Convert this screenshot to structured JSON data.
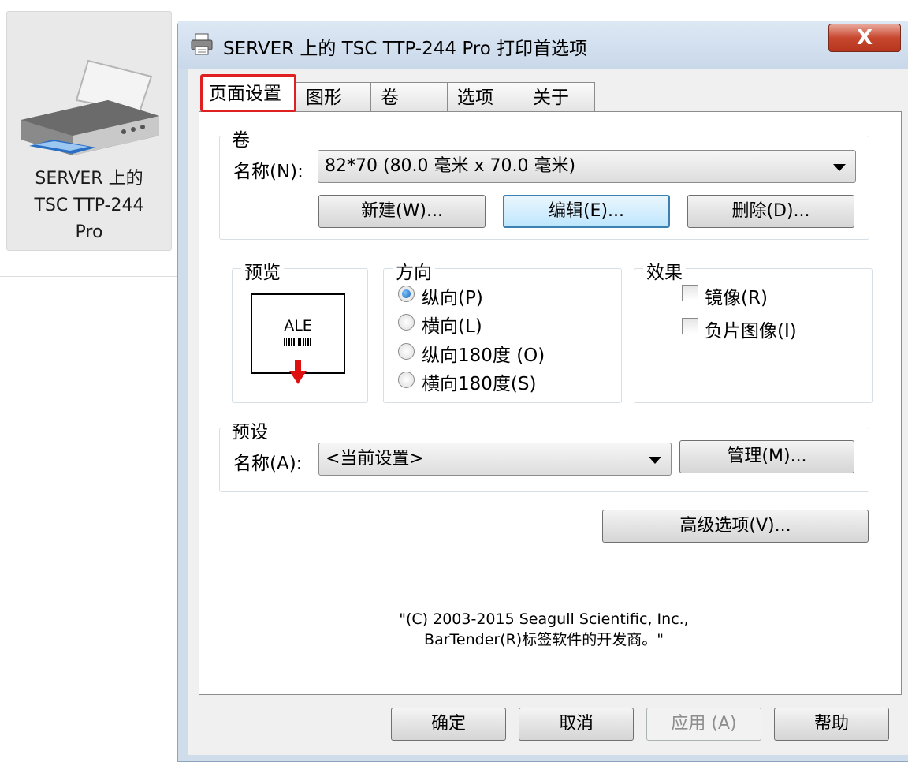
{
  "printer": {
    "label_lines": [
      "SERVER 上的",
      "TSC TTP-244",
      "Pro"
    ]
  },
  "window": {
    "title": "SERVER 上的 TSC TTP-244 Pro 打印首选项",
    "close_glyph": "X"
  },
  "tabs": [
    {
      "label": "页面设置",
      "selected": true
    },
    {
      "label": "图形"
    },
    {
      "label": "卷"
    },
    {
      "label": "选项"
    },
    {
      "label": "关于"
    }
  ],
  "stock": {
    "group_title": "卷",
    "name_label": "名称(N):",
    "selected": "82*70 (80.0 毫米 x 70.0 毫米)",
    "new_button": "新建(W)...",
    "edit_button": "编辑(E)...",
    "delete_button": "删除(D)..."
  },
  "preview": {
    "group_title": "预览",
    "sample_text": "ALE"
  },
  "orientation": {
    "group_title": "方向",
    "options": [
      {
        "label": "纵向(P)",
        "checked": true
      },
      {
        "label": "横向(L)",
        "checked": false
      },
      {
        "label": "纵向180度 (O)",
        "checked": false
      },
      {
        "label": "横向180度(S)",
        "checked": false
      }
    ]
  },
  "effects": {
    "group_title": "效果",
    "options": [
      {
        "label": "镜像(R)",
        "checked": false
      },
      {
        "label": "负片图像(I)",
        "checked": false
      }
    ]
  },
  "preset": {
    "group_title": "预设",
    "name_label": "名称(A):",
    "selected": "<当前设置>",
    "manage_button": "管理(M)..."
  },
  "advanced_button": "高级选项(V)...",
  "copyright": [
    "\"(C) 2003-2015 Seagull Scientific, Inc.,",
    "BarTender(R)标签软件的开发商。\""
  ],
  "footer": {
    "ok": "确定",
    "cancel": "取消",
    "apply": "应用 (A)",
    "help": "帮助"
  },
  "colors": {
    "tab_highlight": "#e02020",
    "focus_border": "#3c7fb1",
    "close_button": "#c8472f"
  }
}
